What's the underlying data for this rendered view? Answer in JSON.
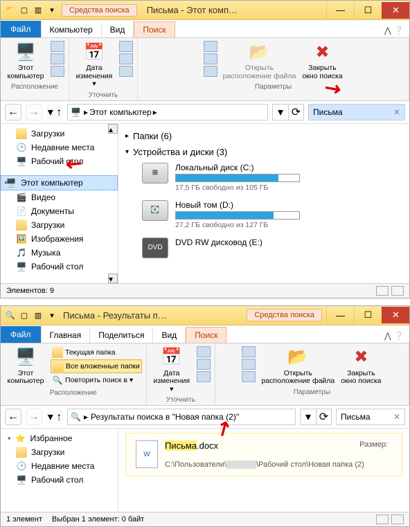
{
  "win1": {
    "context_tab": "Средства поиска",
    "title": "Письма - Этот комп…",
    "tabs": {
      "file": "Файл",
      "computer": "Компьютер",
      "view": "Вид",
      "search": "Поиск"
    },
    "ribbon": {
      "this_pc": "Этот\nкомпьютер",
      "date": "Дата\nизменения ▾",
      "open_loc": "Открыть\nрасположение файла",
      "close_search": "Закрыть\nокно поиска",
      "grp_location": "Расположение",
      "grp_refine": "Уточнить",
      "grp_params": "Параметры"
    },
    "address": {
      "root": "Этот компьютер"
    },
    "search_value": "Письма",
    "sidebar": [
      "Загрузки",
      "Недавние места",
      "Рабочий стол",
      "Этот компьютер",
      "Видео",
      "Документы",
      "Загрузки",
      "Изображения",
      "Музыка",
      "Рабочий стол"
    ],
    "sections": {
      "folders": "Папки (6)",
      "devices": "Устройства и диски (3)"
    },
    "drives": [
      {
        "name": "Локальный диск (C:)",
        "free": "17,5 ГБ свободно из 105 ГБ",
        "fill": 83,
        "icon": "win"
      },
      {
        "name": "Новый том (D:)",
        "free": "27,2 ГБ свободно из 127 ГБ",
        "fill": 79,
        "icon": "hdd"
      },
      {
        "name": "DVD RW дисковод (E:)",
        "free": "",
        "fill": 0,
        "icon": "dvd"
      }
    ],
    "status": "Элементов: 9"
  },
  "win2": {
    "title": "Письма - Результаты п…",
    "context_tab": "Средства поиска",
    "tabs": {
      "file": "Файл",
      "home": "Главная",
      "share": "Поделиться",
      "view": "Вид",
      "search": "Поиск"
    },
    "ribbon": {
      "this_pc": "Этот\nкомпьютер",
      "cur_folder": "Текущая папка",
      "all_sub": "Все вложенные папки",
      "search_again": "Повторить поиск в ▾",
      "date": "Дата\nизменения ▾",
      "open_loc": "Открыть\nрасположение файла",
      "close_search": "Закрыть\nокно поиска",
      "grp_location": "Расположение",
      "grp_refine": "Уточнить",
      "grp_params": "Параметры"
    },
    "address": "Результаты поиска в \"Новая папка (2)\"",
    "search_value": "Письма",
    "sidebar_header": "Избранное",
    "sidebar": [
      "Загрузки",
      "Недавние места",
      "Рабочий стол"
    ],
    "result": {
      "name_hl": "Письма",
      "name_ext": ".docx",
      "size_label": "Размер:",
      "path": "C:\\Пользователи\\",
      "path2": "\\Рабочий стол\\Новая папка (2)"
    },
    "status": "1 элемент",
    "status2": "Выбран 1 элемент: 0 байт"
  }
}
